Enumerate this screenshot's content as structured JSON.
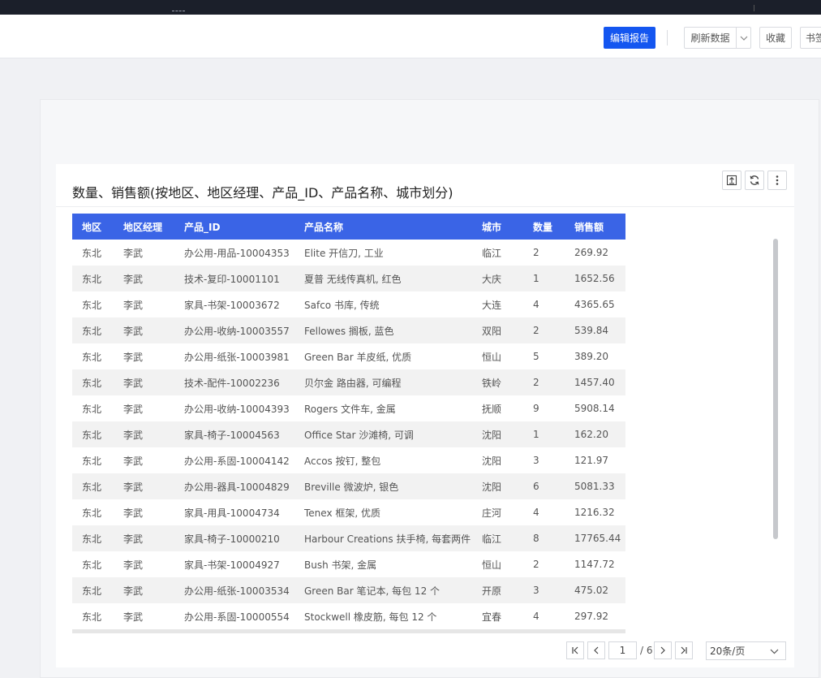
{
  "toolbar": {
    "edit_report_label": "编辑报告",
    "refresh_label": "刷新数据",
    "favorite_label": "收藏",
    "bookmark_label": "书签"
  },
  "widget": {
    "title": "数量、销售额(按地区、地区经理、产品_ID、产品名称、城市划分)"
  },
  "table": {
    "headers": [
      "地区",
      "地区经理",
      "产品_ID",
      "产品名称",
      "城市",
      "数量",
      "销售额"
    ],
    "rows": [
      [
        "东北",
        "李武",
        "办公用-用品-10004353",
        "Elite 开信刀, 工业",
        "临江",
        "2",
        "269.92"
      ],
      [
        "东北",
        "李武",
        "技术-复印-10001101",
        "夏普 无线传真机, 红色",
        "大庆",
        "1",
        "1652.56"
      ],
      [
        "东北",
        "李武",
        "家具-书架-10003672",
        "Safco 书库, 传统",
        "大连",
        "4",
        "4365.65"
      ],
      [
        "东北",
        "李武",
        "办公用-收纳-10003557",
        "Fellowes 搁板, 蓝色",
        "双阳",
        "2",
        "539.84"
      ],
      [
        "东北",
        "李武",
        "办公用-纸张-10003981",
        "Green Bar 羊皮纸, 优质",
        "恒山",
        "5",
        "389.20"
      ],
      [
        "东北",
        "李武",
        "技术-配件-10002236",
        "贝尔金 路由器, 可编程",
        "铁岭",
        "2",
        "1457.40"
      ],
      [
        "东北",
        "李武",
        "办公用-收纳-10004393",
        "Rogers 文件车, 金属",
        "抚顺",
        "9",
        "5908.14"
      ],
      [
        "东北",
        "李武",
        "家具-椅子-10004563",
        "Office Star 沙滩椅, 可调",
        "沈阳",
        "1",
        "162.20"
      ],
      [
        "东北",
        "李武",
        "办公用-系固-10004142",
        "Accos 按钉, 整包",
        "沈阳",
        "3",
        "121.97"
      ],
      [
        "东北",
        "李武",
        "办公用-器具-10004829",
        "Breville 微波炉, 银色",
        "沈阳",
        "6",
        "5081.33"
      ],
      [
        "东北",
        "李武",
        "家具-用具-10004734",
        "Tenex 框架, 优质",
        "庄河",
        "4",
        "1216.32"
      ],
      [
        "东北",
        "李武",
        "家具-椅子-10000210",
        "Harbour Creations 扶手椅, 每套两件",
        "临江",
        "8",
        "17765.44"
      ],
      [
        "东北",
        "李武",
        "家具-书架-10004927",
        "Bush 书架, 金属",
        "恒山",
        "2",
        "1147.72"
      ],
      [
        "东北",
        "李武",
        "办公用-纸张-10003534",
        "Green Bar 笔记本, 每包 12 个",
        "开原",
        "3",
        "475.02"
      ],
      [
        "东北",
        "李武",
        "办公用-系固-10000554",
        "Stockwell 橡皮筋, 每包 12 个",
        "宜春",
        "4",
        "297.92"
      ]
    ]
  },
  "pager": {
    "current_page": "1",
    "total_text": "/ 6",
    "page_size": "20条/页"
  },
  "icons": [
    "export-icon",
    "refresh-icon",
    "more-icon",
    "chevron-down-icon",
    "first-page-icon",
    "prev-page-icon",
    "next-page-icon",
    "last-page-icon"
  ]
}
